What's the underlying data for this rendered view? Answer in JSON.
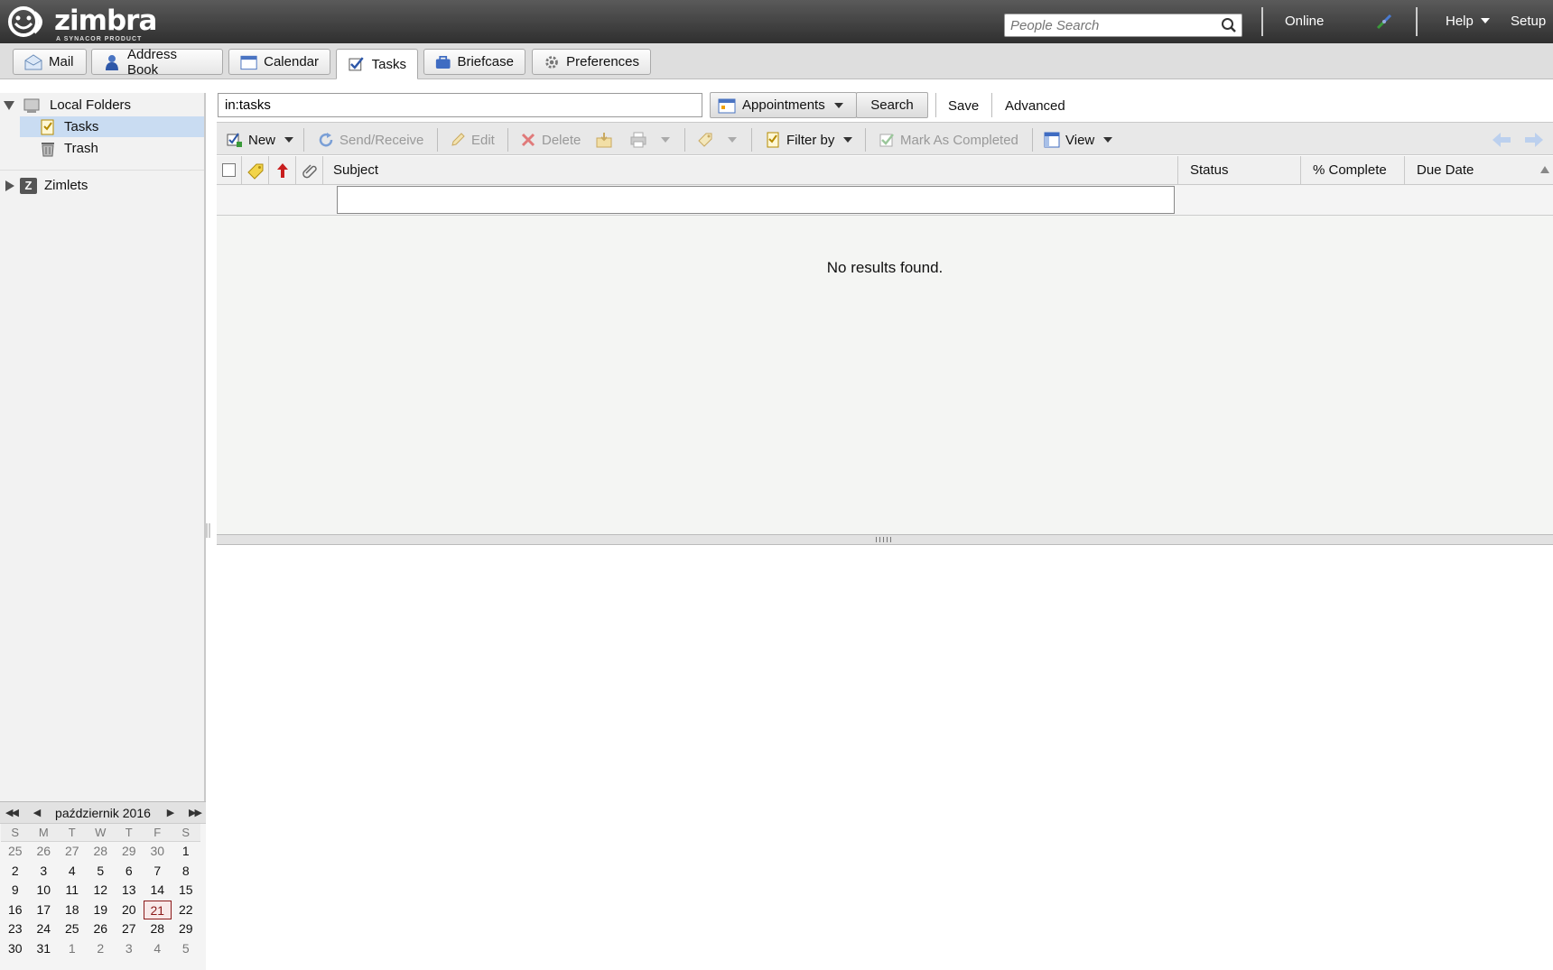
{
  "header": {
    "logo_text": "zimbra",
    "logo_sub": "A SYNACOR PRODUCT",
    "people_search_placeholder": "People Search",
    "status": "Online",
    "help_label": "Help",
    "setup_label": "Setup"
  },
  "apps": [
    {
      "label": "Mail",
      "icon": "envelope-icon"
    },
    {
      "label": "Address Book",
      "icon": "person-icon"
    },
    {
      "label": "Calendar",
      "icon": "calendar-icon"
    },
    {
      "label": "Tasks",
      "icon": "checkbox-icon",
      "active": true
    },
    {
      "label": "Briefcase",
      "icon": "briefcase-icon"
    },
    {
      "label": "Preferences",
      "icon": "gear-icon"
    }
  ],
  "sidebar": {
    "local_folders": "Local Folders",
    "items": [
      {
        "label": "Tasks",
        "icon": "tasks-icon",
        "selected": true
      },
      {
        "label": "Trash",
        "icon": "trash-icon"
      }
    ],
    "zimlets": "Zimlets",
    "zimlets_badge": "Z"
  },
  "search": {
    "query": "in:tasks",
    "scope": "Appointments",
    "search_label": "Search",
    "save_label": "Save",
    "advanced_label": "Advanced"
  },
  "toolbar": {
    "new_label": "New",
    "send_receive_label": "Send/Receive",
    "edit_label": "Edit",
    "delete_label": "Delete",
    "filter_label": "Filter by",
    "mark_completed_label": "Mark As Completed",
    "view_label": "View"
  },
  "list": {
    "columns": [
      "Subject",
      "Status",
      "% Complete",
      "Due Date"
    ],
    "empty_message": "No results found."
  },
  "calendar": {
    "month_label": "październik 2016",
    "dow": [
      "S",
      "M",
      "T",
      "W",
      "T",
      "F",
      "S"
    ],
    "weeks": [
      [
        "25",
        "26",
        "27",
        "28",
        "29",
        "30",
        "1"
      ],
      [
        "2",
        "3",
        "4",
        "5",
        "6",
        "7",
        "8"
      ],
      [
        "9",
        "10",
        "11",
        "12",
        "13",
        "14",
        "15"
      ],
      [
        "16",
        "17",
        "18",
        "19",
        "20",
        "21",
        "22"
      ],
      [
        "23",
        "24",
        "25",
        "26",
        "27",
        "28",
        "29"
      ],
      [
        "30",
        "31",
        "1",
        "2",
        "3",
        "4",
        "5"
      ]
    ],
    "today": "21"
  },
  "colors": {
    "header_bg": "#3d3d3d",
    "selected_row": "#c9dcf2",
    "today_border": "#8b1a1a"
  }
}
